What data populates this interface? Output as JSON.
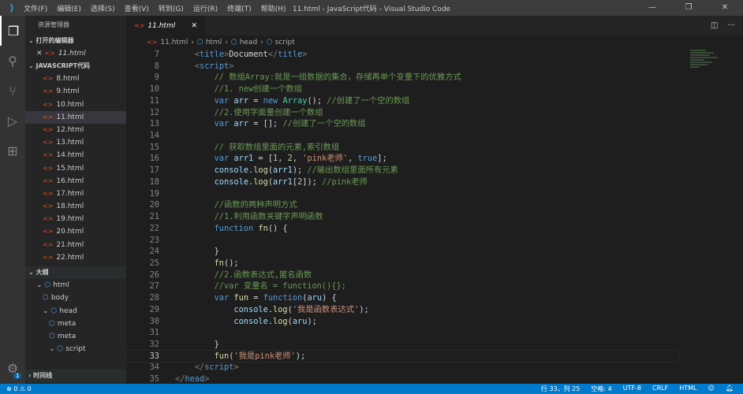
{
  "titlebar": {
    "title": "11.html - JavaScript代码 - Visual Studio Code",
    "menu": [
      "文件(F)",
      "编辑(E)",
      "选择(S)",
      "查看(V)",
      "转到(G)",
      "运行(R)",
      "终端(T)",
      "帮助(H)"
    ]
  },
  "sidebar": {
    "title": "资源管理器",
    "open_editors": "打开的编辑器",
    "open_file": "11.html",
    "folder": "JAVASCRIPT代码",
    "files": [
      "8.html",
      "9.html",
      "10.html",
      "11.html",
      "12.html",
      "13.html",
      "14.html",
      "15.html",
      "16.html",
      "17.html",
      "18.html",
      "19.html",
      "20.html",
      "21.html",
      "22.html"
    ],
    "selected": "11.html",
    "outline_title": "大纲",
    "outline": [
      {
        "label": "html",
        "depth": 0,
        "chev": "⌄"
      },
      {
        "label": "body",
        "depth": 1,
        "chev": ""
      },
      {
        "label": "head",
        "depth": 1,
        "chev": "⌄"
      },
      {
        "label": "meta",
        "depth": 2,
        "chev": ""
      },
      {
        "label": "meta",
        "depth": 2,
        "chev": ""
      },
      {
        "label": "script",
        "depth": 2,
        "chev": "⌄"
      }
    ],
    "timeline": "时间线"
  },
  "activity": {
    "badge": "1"
  },
  "tab": {
    "label": "11.html"
  },
  "breadcrumb": [
    "11.html",
    "html",
    "head",
    "script"
  ],
  "code": {
    "current_line": 33,
    "lines": [
      {
        "n": 7,
        "t": [
          [
            "    ",
            "txt"
          ],
          [
            "<",
            "br"
          ],
          [
            "title",
            "tag"
          ],
          [
            ">",
            "br"
          ],
          [
            "Document",
            "txt"
          ],
          [
            "</",
            "br"
          ],
          [
            "title",
            "tag"
          ],
          [
            ">",
            "br"
          ]
        ]
      },
      {
        "n": 8,
        "t": [
          [
            "    ",
            "txt"
          ],
          [
            "<",
            "br"
          ],
          [
            "script",
            "tag"
          ],
          [
            ">",
            "br"
          ]
        ]
      },
      {
        "n": 9,
        "t": [
          [
            "        // 数组Array:就是一组数据的集合，存储再单个变量下的优雅方式",
            "cm"
          ]
        ]
      },
      {
        "n": 10,
        "t": [
          [
            "        //1. new创建一个数组",
            "cm"
          ]
        ]
      },
      {
        "n": 11,
        "t": [
          [
            "        ",
            "txt"
          ],
          [
            "var",
            "kw"
          ],
          [
            " ",
            "txt"
          ],
          [
            "arr",
            "var"
          ],
          [
            " = ",
            "txt"
          ],
          [
            "new",
            "kw"
          ],
          [
            " ",
            "txt"
          ],
          [
            "Array",
            "cls"
          ],
          [
            "(); ",
            "txt"
          ],
          [
            "//创建了一个空的数组",
            "cm"
          ]
        ]
      },
      {
        "n": 12,
        "t": [
          [
            "        //2.使用字面量创建一个数组",
            "cm"
          ]
        ]
      },
      {
        "n": 13,
        "t": [
          [
            "        ",
            "txt"
          ],
          [
            "var",
            "kw"
          ],
          [
            " ",
            "txt"
          ],
          [
            "arr",
            "var"
          ],
          [
            " = []; ",
            "txt"
          ],
          [
            "//创建了一个空的数组",
            "cm"
          ]
        ]
      },
      {
        "n": 14,
        "t": []
      },
      {
        "n": 15,
        "t": [
          [
            "        // 获取数组里面的元素,索引数组",
            "cm"
          ]
        ]
      },
      {
        "n": 16,
        "t": [
          [
            "        ",
            "txt"
          ],
          [
            "var",
            "kw"
          ],
          [
            " ",
            "txt"
          ],
          [
            "arr1",
            "var"
          ],
          [
            " = [",
            "txt"
          ],
          [
            "1",
            "num"
          ],
          [
            ", ",
            "txt"
          ],
          [
            "2",
            "num"
          ],
          [
            ", ",
            "txt"
          ],
          [
            "'pink老师'",
            "str"
          ],
          [
            ", ",
            "txt"
          ],
          [
            "true",
            "kw"
          ],
          [
            "];",
            "txt"
          ]
        ]
      },
      {
        "n": 17,
        "t": [
          [
            "        ",
            "txt"
          ],
          [
            "console",
            "var"
          ],
          [
            ".",
            "txt"
          ],
          [
            "log",
            "fn"
          ],
          [
            "(",
            "txt"
          ],
          [
            "arr1",
            "var"
          ],
          [
            "); ",
            "txt"
          ],
          [
            "//输出数组里面所有元素",
            "cm"
          ]
        ]
      },
      {
        "n": 18,
        "t": [
          [
            "        ",
            "txt"
          ],
          [
            "console",
            "var"
          ],
          [
            ".",
            "txt"
          ],
          [
            "log",
            "fn"
          ],
          [
            "(",
            "txt"
          ],
          [
            "arr1",
            "var"
          ],
          [
            "[",
            "txt"
          ],
          [
            "2",
            "num"
          ],
          [
            "]); ",
            "txt"
          ],
          [
            "//pink老师",
            "cm"
          ]
        ]
      },
      {
        "n": 19,
        "t": []
      },
      {
        "n": 20,
        "t": [
          [
            "        //函数的两种声明方式",
            "cm"
          ]
        ]
      },
      {
        "n": 21,
        "t": [
          [
            "        //1.利用函数关键字声明函数",
            "cm"
          ]
        ]
      },
      {
        "n": 22,
        "t": [
          [
            "        ",
            "txt"
          ],
          [
            "function",
            "kw"
          ],
          [
            " ",
            "txt"
          ],
          [
            "fn",
            "fn"
          ],
          [
            "() {",
            "txt"
          ]
        ]
      },
      {
        "n": 23,
        "t": []
      },
      {
        "n": 24,
        "t": [
          [
            "        }",
            "txt"
          ]
        ]
      },
      {
        "n": 25,
        "t": [
          [
            "        ",
            "txt"
          ],
          [
            "fn",
            "fn"
          ],
          [
            "();",
            "txt"
          ]
        ]
      },
      {
        "n": 26,
        "t": [
          [
            "        //2.函数表达式,匿名函数",
            "cm"
          ]
        ]
      },
      {
        "n": 27,
        "t": [
          [
            "        //var 变量名 = function(){};",
            "cm"
          ]
        ]
      },
      {
        "n": 28,
        "t": [
          [
            "        ",
            "txt"
          ],
          [
            "var",
            "kw"
          ],
          [
            " ",
            "txt"
          ],
          [
            "fun",
            "fn"
          ],
          [
            " = ",
            "txt"
          ],
          [
            "function",
            "kw"
          ],
          [
            "(",
            "txt"
          ],
          [
            "aru",
            "var"
          ],
          [
            ") {",
            "txt"
          ]
        ]
      },
      {
        "n": 29,
        "t": [
          [
            "            ",
            "txt"
          ],
          [
            "console",
            "var"
          ],
          [
            ".",
            "txt"
          ],
          [
            "log",
            "fn"
          ],
          [
            "(",
            "txt"
          ],
          [
            "'我是函数表达式'",
            "str"
          ],
          [
            ");",
            "txt"
          ]
        ]
      },
      {
        "n": 30,
        "t": [
          [
            "            ",
            "txt"
          ],
          [
            "console",
            "var"
          ],
          [
            ".",
            "txt"
          ],
          [
            "log",
            "fn"
          ],
          [
            "(",
            "txt"
          ],
          [
            "aru",
            "var"
          ],
          [
            ");",
            "txt"
          ]
        ]
      },
      {
        "n": 31,
        "t": []
      },
      {
        "n": 32,
        "t": [
          [
            "        }",
            "txt"
          ]
        ]
      },
      {
        "n": 33,
        "t": [
          [
            "        ",
            "txt"
          ],
          [
            "fun",
            "fn"
          ],
          [
            "(",
            "txt"
          ],
          [
            "'我是pink老师'",
            "str"
          ],
          [
            ");",
            "txt"
          ]
        ]
      },
      {
        "n": 34,
        "t": [
          [
            "    ",
            "txt"
          ],
          [
            "</",
            "br"
          ],
          [
            "script",
            "tag"
          ],
          [
            ">",
            "br"
          ]
        ]
      },
      {
        "n": 35,
        "t": [
          [
            "</",
            "br"
          ],
          [
            "head",
            "tag"
          ],
          [
            ">",
            "br"
          ]
        ]
      }
    ]
  },
  "statusbar": {
    "errors": "0",
    "warnings": "0",
    "position": "行 33，列 25",
    "indent": "空格: 4",
    "encoding": "UTF-8",
    "eol": "CRLF",
    "language": "HTML"
  }
}
